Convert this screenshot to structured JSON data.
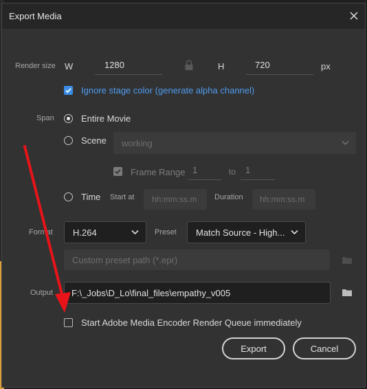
{
  "dialog": {
    "title": "Export Media"
  },
  "render_size": {
    "label": "Render size",
    "w_label": "W",
    "w_value": "1280",
    "h_label": "H",
    "h_value": "720",
    "unit": "px"
  },
  "ignore_stage": {
    "label": "Ignore stage color (generate alpha channel)",
    "checked": true
  },
  "span": {
    "label": "Span",
    "entire_movie": "Entire Movie",
    "scene": "Scene",
    "scene_value": "working",
    "frame_range_label": "Frame Range",
    "frame_from": "1",
    "frame_to_label": "to",
    "frame_to": "1",
    "time": "Time",
    "start_at_label": "Start at",
    "start_at_placeholder": "hh:mm:ss.m",
    "duration_label": "Duration",
    "duration_placeholder": "hh:mm:ss.m",
    "selected": "Entire Movie"
  },
  "format": {
    "label": "Format",
    "value": "H.264",
    "preset_label": "Preset",
    "preset_value": "Match Source - High...",
    "custom_preset_placeholder": "Custom preset path (*.epr)"
  },
  "output": {
    "label": "Output",
    "value": "F:\\_Jobs\\D_Lo\\final_files\\empathy_v005"
  },
  "encoder_queue": {
    "label": "Start Adobe Media Encoder Render Queue immediately",
    "checked": false
  },
  "buttons": {
    "export": "Export",
    "cancel": "Cancel"
  },
  "colors": {
    "accent": "#3b8ee8",
    "annotation_arrow": "#e8141a",
    "dialog_bg": "#323232"
  }
}
